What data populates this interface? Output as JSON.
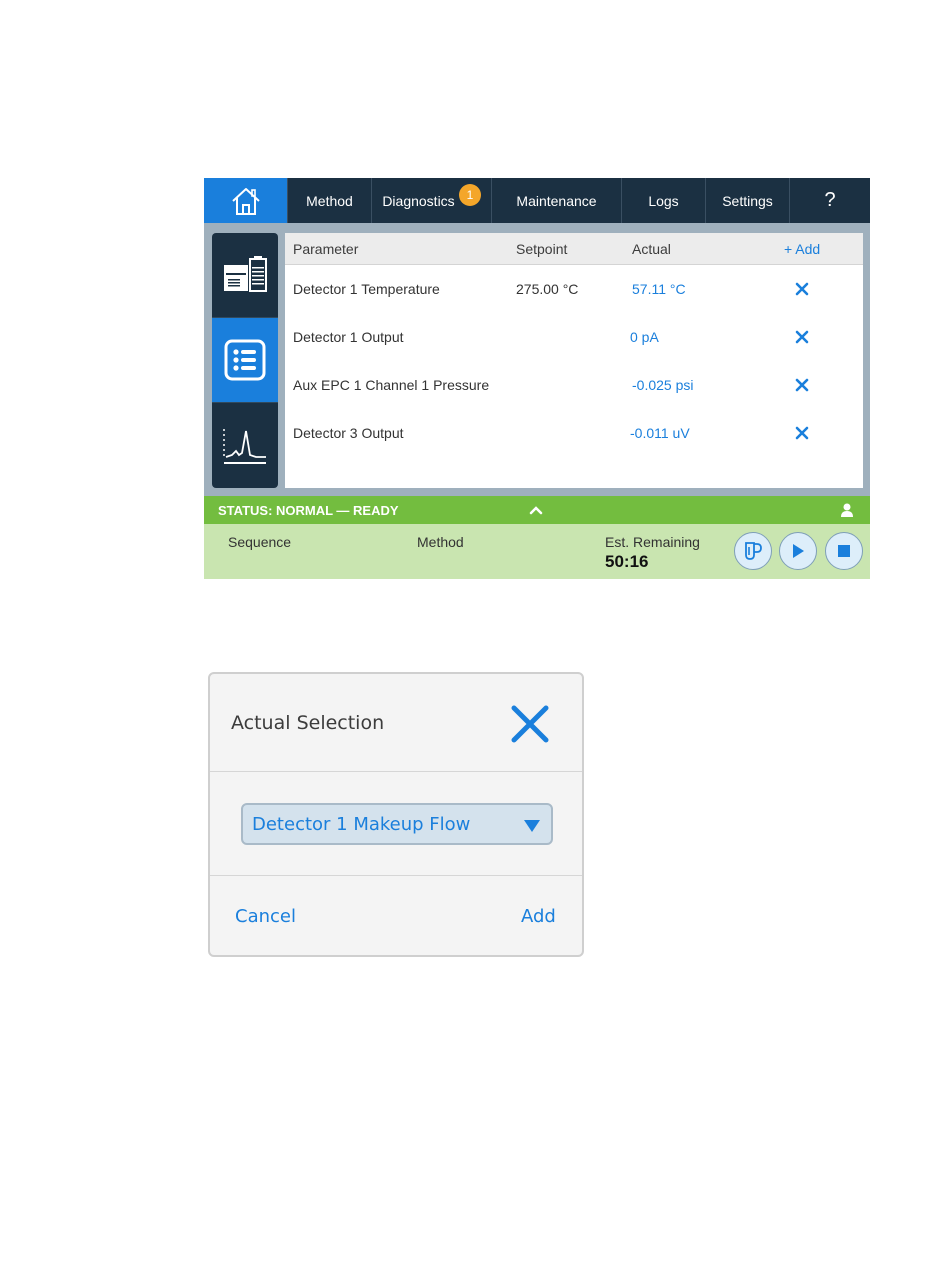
{
  "nav": {
    "tabs": [
      {
        "label": "Method"
      },
      {
        "label": "Diagnostics",
        "badge": "1"
      },
      {
        "label": "Maintenance"
      },
      {
        "label": "Logs"
      },
      {
        "label": "Settings"
      },
      {
        "label": "?"
      }
    ]
  },
  "sidebar": {
    "items": [
      {
        "icon": "instrument-icon",
        "active": false
      },
      {
        "icon": "list-icon",
        "active": true
      },
      {
        "icon": "chromatogram-icon",
        "active": false
      }
    ]
  },
  "table": {
    "headers": {
      "parameter": "Parameter",
      "setpoint": "Setpoint",
      "actual": "Actual",
      "add": "+ Add"
    },
    "rows": [
      {
        "parameter": "Detector 1 Temperature",
        "setpoint": "275.00 °C",
        "actual": "57.11 °C"
      },
      {
        "parameter": "Detector 1 Output",
        "setpoint": "",
        "actual": "0 pA"
      },
      {
        "parameter": "Aux EPC 1 Channel 1 Pressure",
        "setpoint": "",
        "actual": "-0.025 psi"
      },
      {
        "parameter": "Detector 3 Output",
        "setpoint": "",
        "actual": "-0.011 uV"
      }
    ]
  },
  "status": {
    "text": "STATUS: NORMAL — READY"
  },
  "bottom": {
    "sequence": "Sequence",
    "method": "Method",
    "remaining_label": "Est. Remaining",
    "remaining_value": "50:16"
  },
  "dialog": {
    "title": "Actual Selection",
    "selected": "Detector 1 Makeup Flow",
    "cancel": "Cancel",
    "add": "Add"
  },
  "colors": {
    "accent": "#1a7fdc",
    "nav": "#1b3042",
    "status_green": "#73bd3f",
    "badge": "#f4a62a"
  }
}
